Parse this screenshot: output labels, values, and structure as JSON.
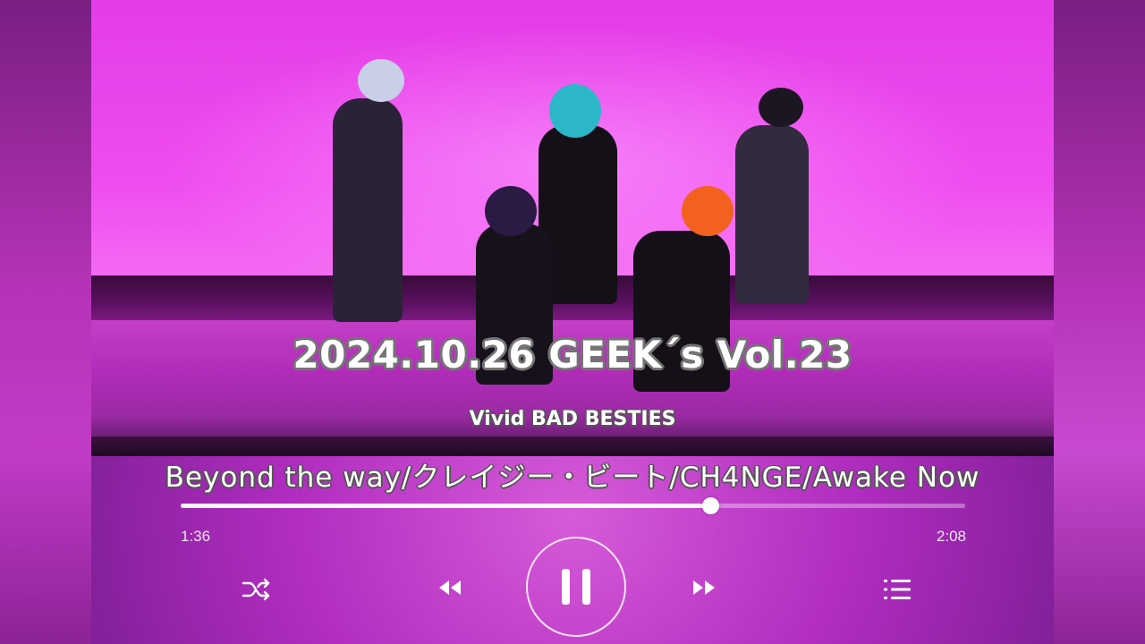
{
  "overlay": {
    "event_title": "2024.10.26 GEEK´s Vol.23",
    "group_name": "Vivid BAD BESTIES",
    "track_list": "Beyond the way/クレイジー・ビート/CH4NGE/Awake Now"
  },
  "player": {
    "current_time": "1:36",
    "total_time": "2:08",
    "progress": 0.675,
    "state": "playing",
    "controls": [
      "shuffle-icon",
      "previous-icon",
      "pause-icon",
      "next-icon",
      "queue-icon"
    ]
  },
  "colors": {
    "stage_backdrop": "#ee4cf0",
    "background": "#b12cc0",
    "text": "#ffffff"
  }
}
